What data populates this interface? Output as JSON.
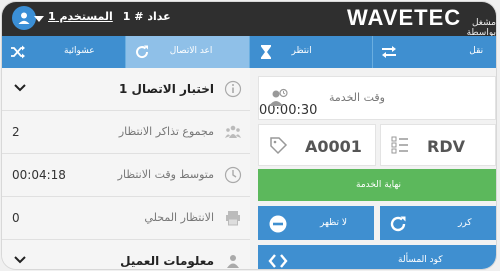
{
  "header": {
    "brand": "WAVETEC",
    "powered_by": "مشغل بواسطة",
    "counter_label": "عداد # 1",
    "user_label": "المستخدم 1"
  },
  "actions": [
    {
      "label": "نقل",
      "icon": "transfer-arrows-icon"
    },
    {
      "label": "انتظر",
      "icon": "hourglass-icon"
    },
    {
      "label": "اعد الاتصال",
      "icon": "refresh-icon"
    },
    {
      "label": "عشوائية",
      "icon": "shuffle-icon"
    }
  ],
  "left_panel": {
    "section_title": "اختبار الاتصال 1",
    "rows": [
      {
        "title": "مجموع تذاكر الانتظار",
        "value": "2",
        "icon": "people-group-icon"
      },
      {
        "title": "متوسط وقت الانتظار",
        "value": "00:04:18",
        "icon": "clock-icon"
      },
      {
        "title": "الانتظار المحلي",
        "value": "0",
        "icon": "printer-icon"
      }
    ],
    "customer_section_title": "معلومات العميل"
  },
  "right_panel": {
    "service_time_label": "وقت الخدمة",
    "service_time_value": "00:00:30",
    "ticket": "A0001",
    "queue": "RDV",
    "end_service_label": "نهاية الخدمة",
    "no_show_label": "لا تظهر",
    "recall_label": "كرر",
    "issue_code_label": "كود المسألة"
  },
  "colors": {
    "topbar": "#2f2f2f",
    "action_blue": "#3f8fd0",
    "action_active": "#8fc0e8",
    "green": "#5cb85c",
    "btn_blue": "#3f8fd0"
  }
}
